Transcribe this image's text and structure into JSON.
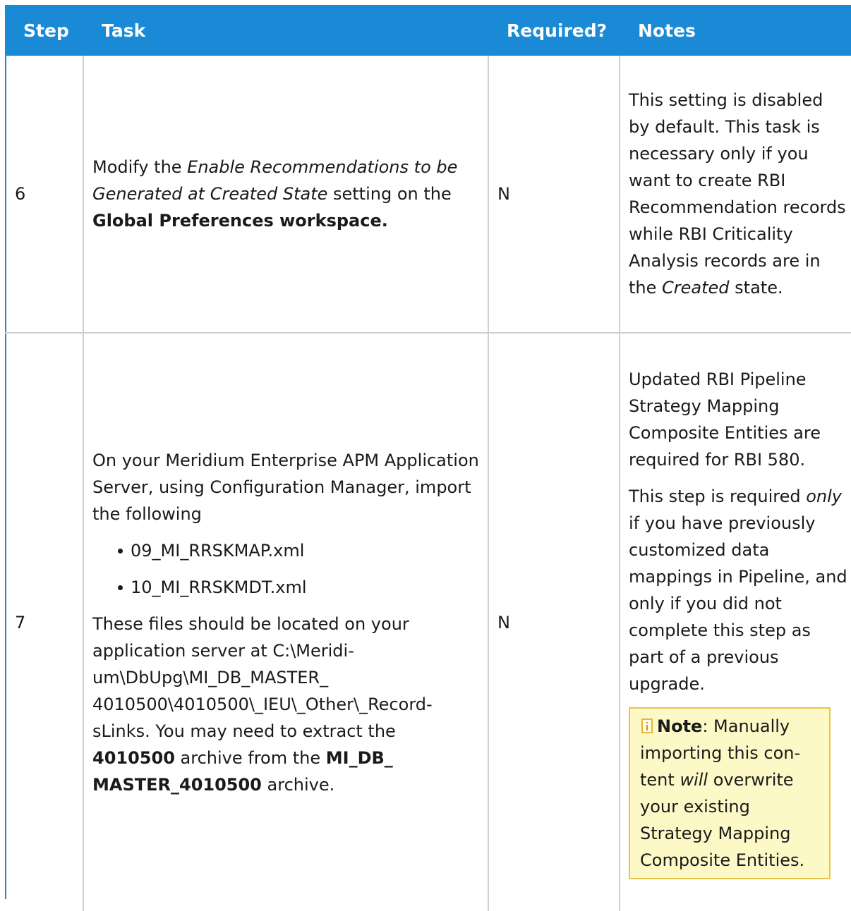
{
  "table": {
    "headers": {
      "step": "Step",
      "task": "Task",
      "required": "Required?",
      "notes": "Notes"
    },
    "rows": [
      {
        "step": "6",
        "task": {
          "pre": "Modify the ",
          "setting": "Enable Recommendations to be Generated at Created State",
          "mid": " setting on the ",
          "workspace": "Global Preferences workspace."
        },
        "required": "N",
        "notes": {
          "pre": "This setting is disabled by default. This task is necessary only if you want to create RBI Recommendation records while RBI Crit­icality Analysis records are in the ",
          "state": "Created",
          "post": " state."
        }
      },
      {
        "step": "7",
        "task": {
          "intro": "On your Meridium Enterprise APM Application Server, using Configuration Manager, import the fol­lowing",
          "files": [
            "09_MI_RRSKMAP.xml",
            "10_MI_RRSKMDT.xml"
          ],
          "location_pre": "These files should be located on your application server at C:\\Meridi­um\\DbUpg\\MI_DB_MASTER_ 4010500\\4010500\\_IEU\\_Other\\_Record­sLinks. You may need to extract the ",
          "archive": "4010500",
          "location_mid": " archive from the ",
          "master_archive": "MI_DB_ MASTER_4010500",
          "location_post": " archive."
        },
        "required": "N",
        "notes": {
          "para1": "Updated RBI Pipeline Strategy Mapping Composite Entities are required for RBI 580.",
          "para2_pre": "This step is required ",
          "para2_em": "only",
          "para2_post": " if you have pre­viously customized data mappings in Pipeline, and only if you did not complete this step as part of a previous upgrade.",
          "note_label": "Note",
          "note_pre": ": Manually importing this con­tent ",
          "note_em": "will",
          "note_post": " overwrite your existing Strategy Mapping Composite Entities."
        }
      }
    ]
  },
  "colors": {
    "header_bg": "#1a8ad6",
    "header_text": "#ffffff",
    "note_bg": "#fdf9c7",
    "note_border": "#e8c548"
  }
}
